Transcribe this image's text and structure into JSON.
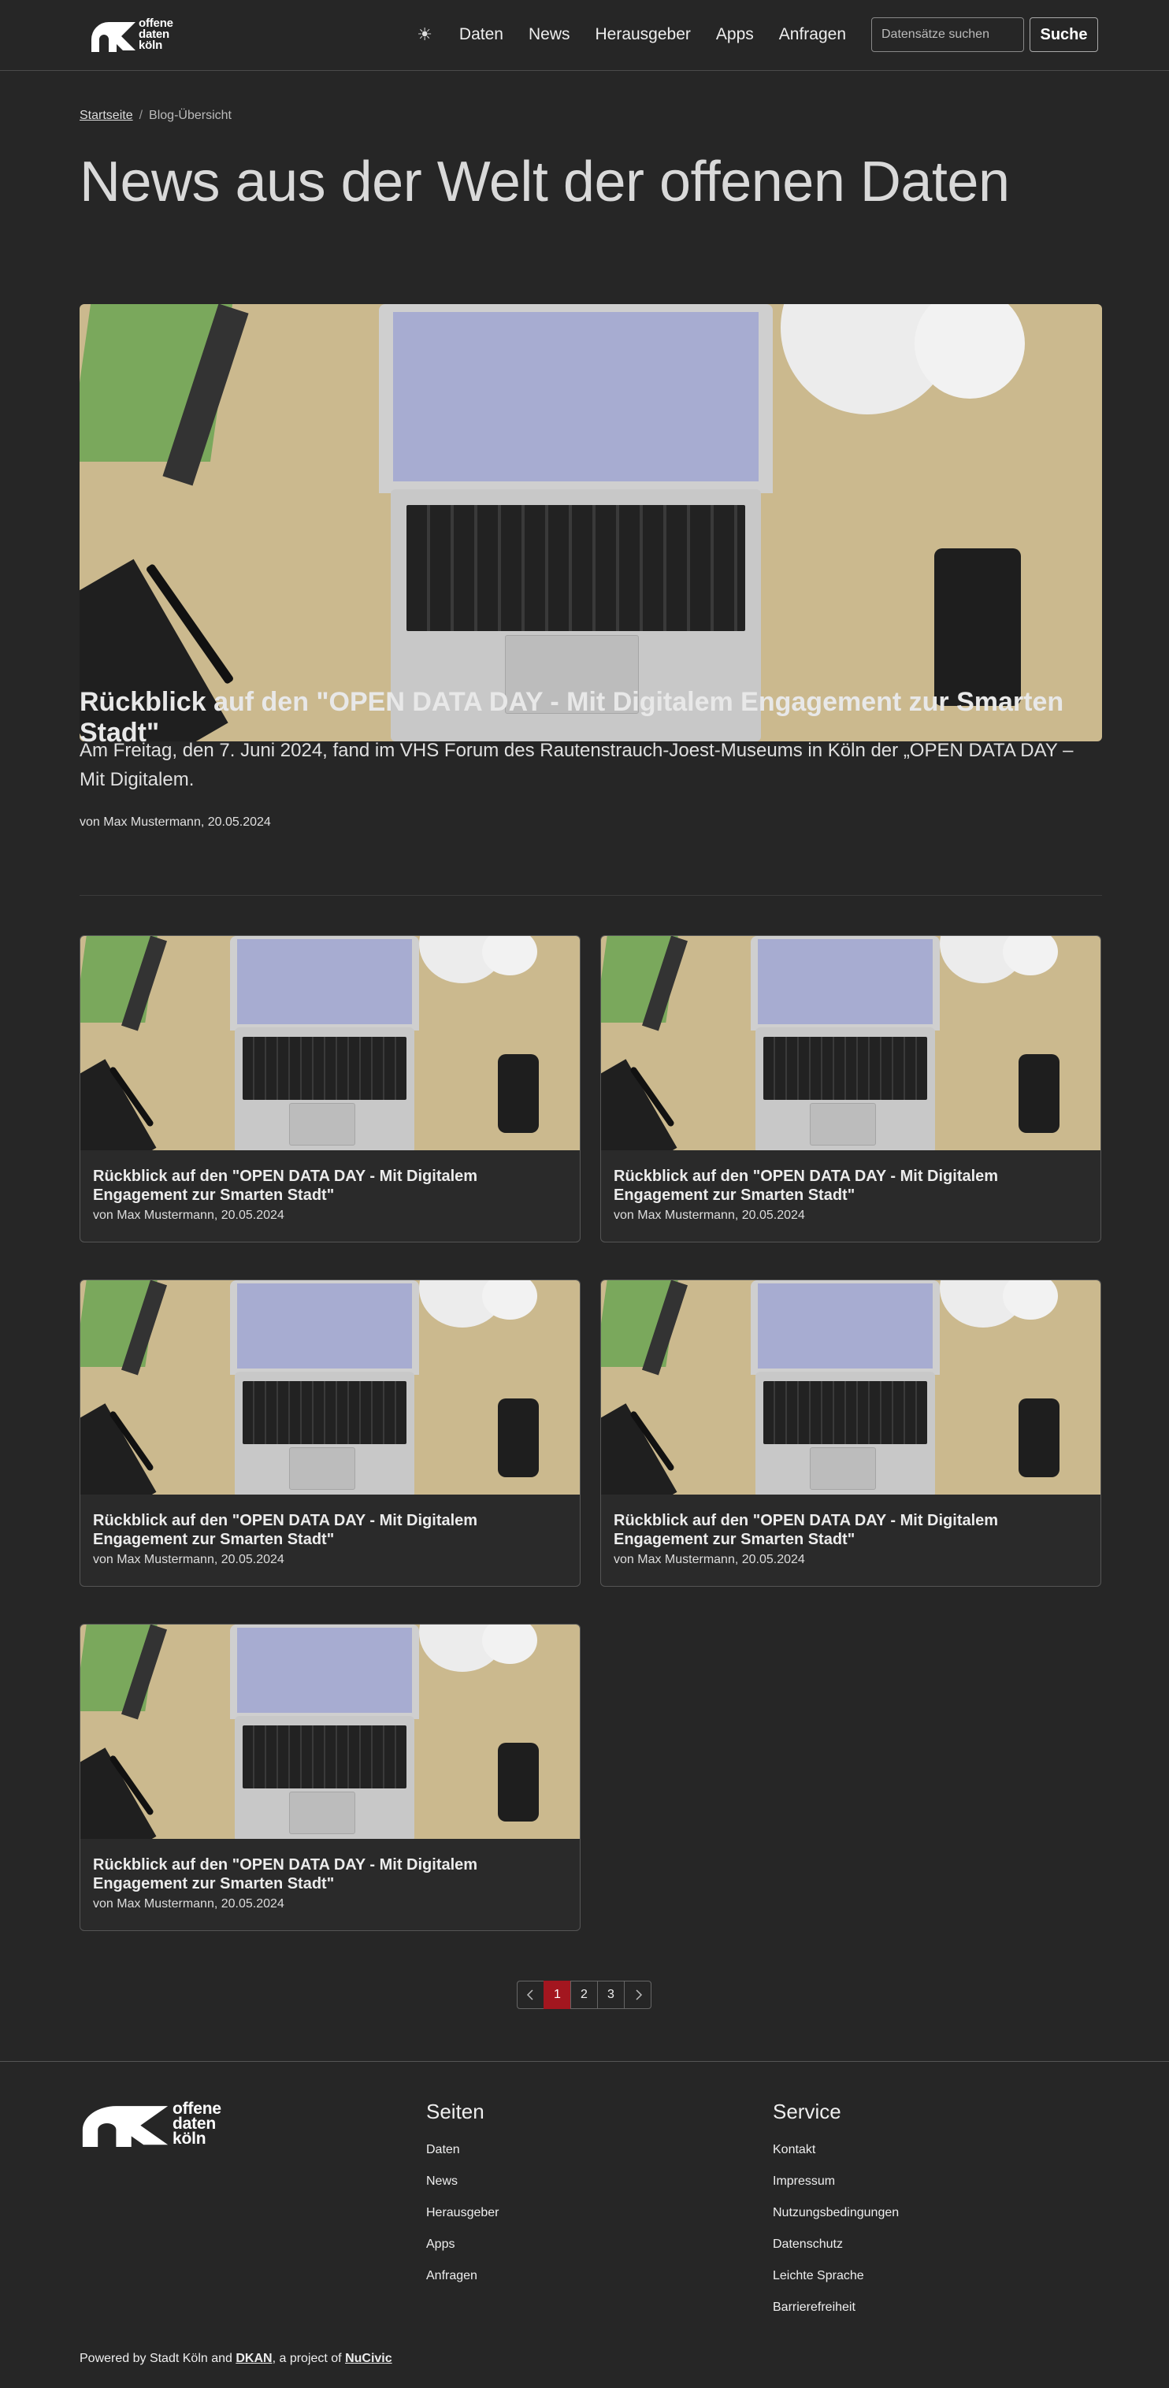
{
  "header": {
    "logo_text": [
      "offene",
      "daten",
      "köln"
    ],
    "theme_icon": "sun-icon",
    "nav": [
      "Daten",
      "News",
      "Herausgeber",
      "Apps",
      "Anfragen"
    ],
    "search_placeholder": "Datensätze suchen",
    "search_button": "Suche"
  },
  "breadcrumb": {
    "home": "Startseite",
    "separator": "/",
    "current": "Blog-Übersicht"
  },
  "page_title": "News aus der Welt der offenen Daten",
  "featured": {
    "title": "Rückblick auf den \"OPEN DATA DAY - Mit Digitalem Engagement zur Smarten Stadt\"",
    "excerpt": "Am Freitag, den 7. Juni 2024, fand im VHS Forum des Rautenstrauch-Joest-Museums in Köln der „OPEN DATA DAY – Mit Digitalem.",
    "meta": "von Max Mustermann, 20.05.2024"
  },
  "cards": [
    {
      "title": "Rückblick auf den \"OPEN DATA DAY - Mit Digitalem Engagement zur Smarten Stadt\"",
      "meta": "von Max Mustermann, 20.05.2024"
    },
    {
      "title": "Rückblick auf den \"OPEN DATA DAY - Mit Digitalem Engagement zur Smarten Stadt\"",
      "meta": "von Max Mustermann, 20.05.2024"
    },
    {
      "title": "Rückblick auf den \"OPEN DATA DAY - Mit Digitalem Engagement zur Smarten Stadt\"",
      "meta": "von Max Mustermann, 20.05.2024"
    },
    {
      "title": "Rückblick auf den \"OPEN DATA DAY - Mit Digitalem Engagement zur Smarten Stadt\"",
      "meta": "von Max Mustermann, 20.05.2024"
    },
    {
      "title": "Rückblick auf den \"OPEN DATA DAY - Mit Digitalem Engagement zur Smarten Stadt\"",
      "meta": "von Max Mustermann, 20.05.2024"
    }
  ],
  "pagination": {
    "prev_icon": "chevron-left-icon",
    "pages": [
      "1",
      "2",
      "3"
    ],
    "current": "1",
    "next_icon": "chevron-right-icon"
  },
  "footer": {
    "logo_text": [
      "offene",
      "daten",
      "köln"
    ],
    "pages_heading": "Seiten",
    "pages_links": [
      "Daten",
      "News",
      "Herausgeber",
      "Apps",
      "Anfragen"
    ],
    "service_heading": "Service",
    "service_links": [
      "Kontakt",
      "Impressum",
      "Nutzungsbedingungen",
      "Datenschutz",
      "Leichte Sprache",
      "Barrierefreiheit"
    ],
    "powered_prefix": "Powered by Stadt Köln and ",
    "powered_dkan": "DKAN",
    "powered_mid": ", a project of ",
    "powered_nucivic": "NuCivic"
  },
  "colors": {
    "background": "#262626",
    "accent": "#a3161f",
    "text": "#e6e6e6"
  }
}
